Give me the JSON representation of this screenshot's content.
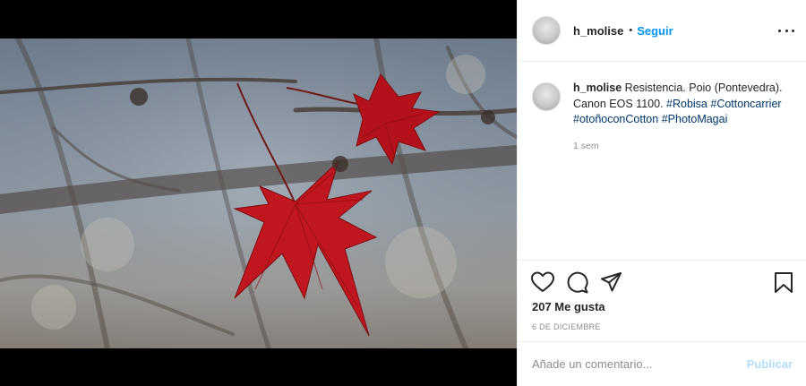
{
  "post": {
    "username": "h_molise",
    "follow_label": "Seguir",
    "separator": "•",
    "more_icon": "more-horizontal-icon"
  },
  "caption": {
    "username": "h_molise",
    "text": "Resistencia. Poio (Pontevedra). Canon EOS 1100.",
    "hashtags": [
      "#Robisa",
      "#Cottoncarrier",
      "#otoñoconCotton",
      "#PhotoMagai"
    ],
    "time": "1 sem"
  },
  "actions": {
    "like_icon": "heart-icon",
    "comment_icon": "comment-icon",
    "share_icon": "paper-plane-icon",
    "save_icon": "bookmark-icon",
    "likes_text": "207 Me gusta",
    "date_text": "6 de diciembre"
  },
  "comment": {
    "placeholder": "Añade un comentario...",
    "publish_label": "Publicar"
  },
  "colors": {
    "link_blue": "#0095f6",
    "publish_disabled": "#b2dffc",
    "leaf_red": "#b3121a"
  }
}
